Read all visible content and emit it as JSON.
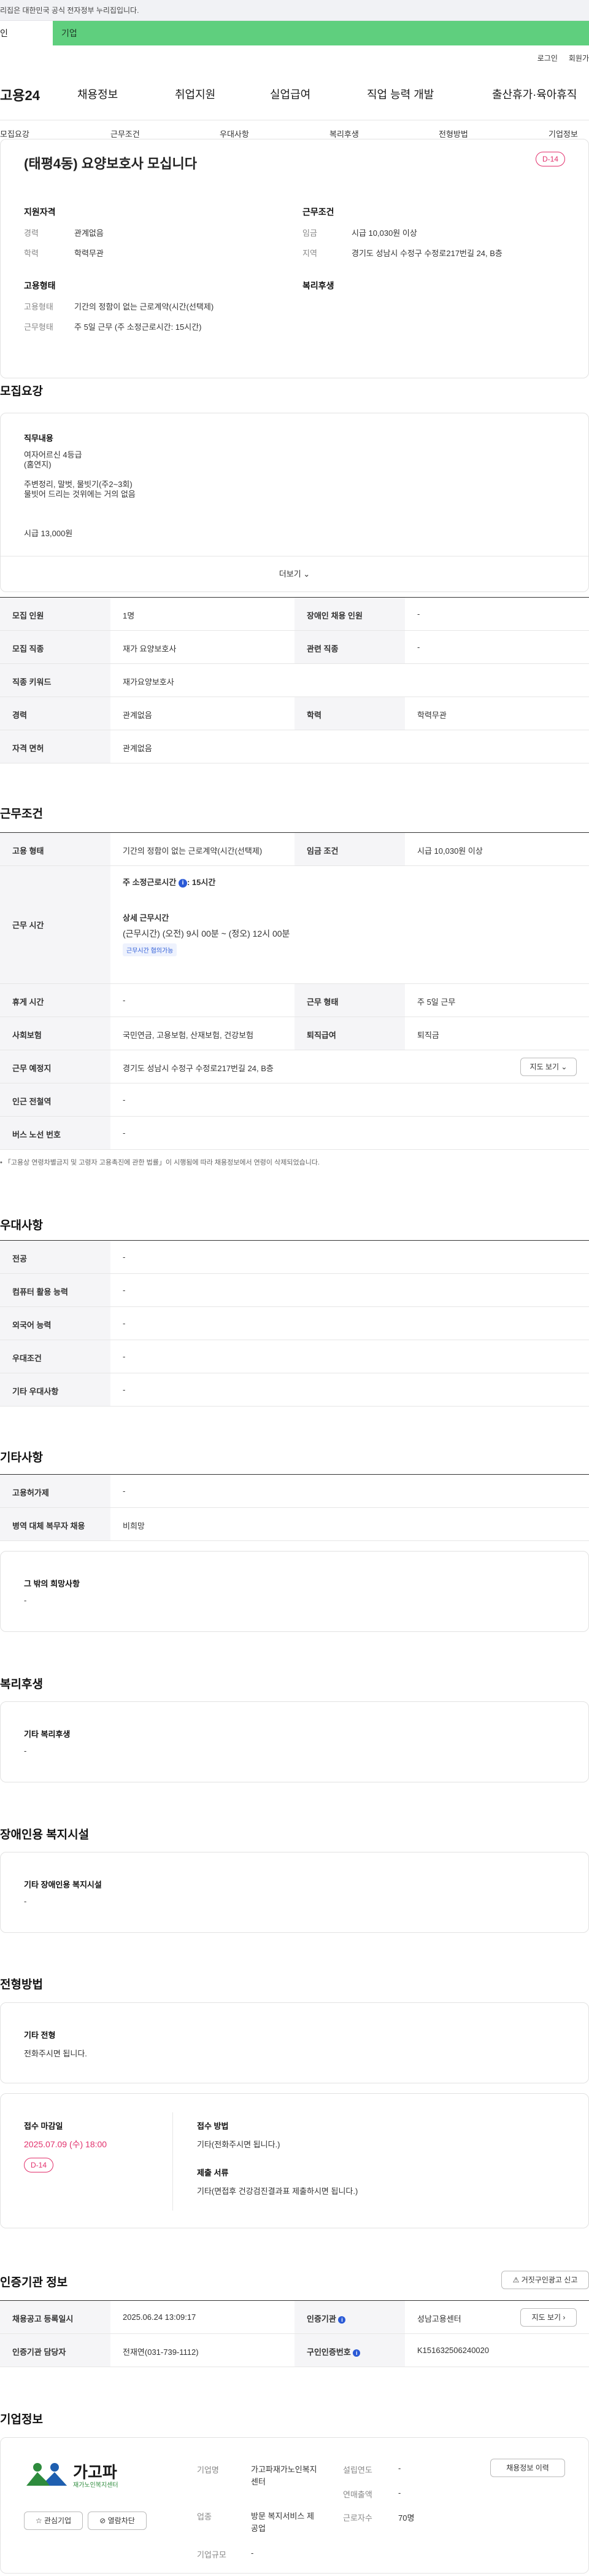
{
  "gov_banner": "이 누리집은 대한민국 공식 전자정부 누리집입니다.",
  "gov_banner_visible": "리집은 대한민국 공식 전자정부 누리집입니다.",
  "top_tabs": {
    "personal": "인",
    "company": "기업"
  },
  "util": {
    "login": "로그인",
    "join": "회원가"
  },
  "gnb": {
    "logo": "고용24",
    "items": [
      "채용정보",
      "취업지원",
      "실업급여",
      "직업 능력 개발",
      "출산휴가·육아휴직"
    ]
  },
  "snb": [
    "모집요강",
    "근무조건",
    "우대사항",
    "복리후생",
    "전형방법",
    "기업정보"
  ],
  "job": {
    "title": "(태평4동) 요양보호사 모십니다",
    "dday": "D-14",
    "qualification_h": "지원자격",
    "career_l": "경력",
    "career": "관계없음",
    "edu_l": "학력",
    "edu": "학력무관",
    "employ_h": "고용형태",
    "emptype_l": "고용형태",
    "emptype": "기간의 정함이 없는 근로계약(시간(선택제)",
    "worktype_l": "근무형태",
    "worktype": "주 5일 근무 (주 소정근로시간: 15시간)",
    "cond_h": "근무조건",
    "wage_l": "임금",
    "wage": "시급 10,030원 이상",
    "region_l": "지역",
    "region": "경기도 성남시 수정구 수정로217번길 24, B층",
    "welfare_h": "복리후생"
  },
  "recruit": {
    "title": "모집요강",
    "duty_h": "직무내용",
    "duty_lines": [
      "여자어르신 4등급",
      "(홈연지)",
      "",
      "주변정리, 말벗, 물빗기(주2~3회)",
      "물빗어 드리는 것위에는 거의 없음",
      "",
      "",
      "시급 13,000원"
    ],
    "more": "더보기",
    "table": [
      {
        "l1": "모집 인원",
        "v1": "1명",
        "l2": "장애인 채용 인원",
        "v2": "-"
      },
      {
        "l1": "모집 직종",
        "v1": "재가 요양보호사",
        "l2": "관련 직종",
        "v2": "-"
      },
      {
        "l1": "직종 키워드",
        "v1": "재가요양보호사"
      },
      {
        "l1": "경력",
        "v1": "관계없음",
        "l2": "학력",
        "v2": "학력무관"
      },
      {
        "l1": "자격 면허",
        "v1": "관계없음"
      }
    ]
  },
  "work": {
    "title": "근무조건",
    "emptype_l": "고용 형태",
    "emptype": "기간의 정함이 없는 근로계약(시간(선택제)",
    "wage_l": "임금 조건",
    "wage": "시급 10,030원 이상",
    "time_l": "근무 시간",
    "weekly": "주 소정근로시간",
    "weekly_hours": ": 15시간",
    "detail_h": "상세 근무시간",
    "detail": "(근무시간) (오전) 9시 00분 ~ (정오) 12시 00분",
    "negotiable": "근무시간 협의가능",
    "break_l": "휴게 시간",
    "break": "-",
    "worktype_l": "근무 형태",
    "worktype": "주 5일 근무",
    "insurance_l": "사회보험",
    "insurance": "국민연금, 고용보험, 산재보험, 건강보험",
    "severance_l": "퇴직급여",
    "severance": "퇴직금",
    "location_l": "근무 예정지",
    "location": "경기도 성남시 수정구 수정로217번길 24, B층",
    "map_btn": "지도 보기",
    "subway_l": "인근 전철역",
    "subway": "-",
    "bus_l": "버스 노선 번호",
    "bus": "-",
    "note": "「고용상 연령차별금지 및 고령자 고용촉진에 관한 법률」이 시행됨에 따라 채용정보에서 연령이 삭제되었습니다."
  },
  "pref": {
    "title": "우대사항",
    "rows": [
      {
        "l": "전공",
        "v": "-"
      },
      {
        "l": "컴퓨터 활용 능력",
        "v": "-"
      },
      {
        "l": "외국어 능력",
        "v": "-"
      },
      {
        "l": "우대조건",
        "v": "-"
      },
      {
        "l": "기타 우대사항",
        "v": "-"
      }
    ]
  },
  "etc": {
    "title": "기타사항",
    "rows": [
      {
        "l": "고용허가제",
        "v": "-"
      },
      {
        "l": "병역 대체 복무자 채용",
        "v": "비희망"
      }
    ],
    "wish_h": "그 밖의 희망사항",
    "wish": "-"
  },
  "welfare": {
    "title": "복리후생",
    "h": "기타 복리후생",
    "v": "-"
  },
  "disabled": {
    "title": "장애인용 복지시설",
    "h": "기타 장애인용 복지시설",
    "v": "-"
  },
  "screening": {
    "title": "전형방법",
    "etc_h": "기타 전형",
    "etc_v": "전화주시면 됩니다.",
    "deadline_h": "접수 마감일",
    "deadline": "2025.07.09 (수) 18:00",
    "dday": "D-14",
    "method_h": "접수 방법",
    "method": "기타(전화주시면 됩니다.)",
    "docs_h": "제출 서류",
    "docs": "기타(면접후 건강검진결과표 제출하시면 됩니다.)"
  },
  "agency": {
    "title": "인증기관 정보",
    "report_btn": "거짓구인광고 신고",
    "reg_l": "채용공고 등록일시",
    "reg": "2025.06.24 13:09:17",
    "org_l": "인증기관",
    "org": "성남고용센터",
    "map_btn": "지도 보기",
    "mgr_l": "인증기관 담당자",
    "mgr": "전재연(031-739-1112)",
    "no_l": "구인인증번호",
    "no": "K151632506240020"
  },
  "company": {
    "title": "기업정보",
    "logo_main": "가고파",
    "logo_sub": "재가노인복지센터",
    "fav_btn": "관심기업",
    "block_btn": "열람차단",
    "name_l": "기업명",
    "name": "가고파재가노인복지센터",
    "founded_l": "설립연도",
    "founded": "-",
    "industry_l": "업종",
    "industry": "방문 복지서비스 제공업",
    "revenue_l": "연매출액",
    "revenue": "-",
    "staff_l": "근로자수",
    "staff": "70명",
    "size_l": "기업규모",
    "size": "-",
    "jobs_btn": "채용정보 이력"
  },
  "colors": {
    "green": "#5fcf7e",
    "dday": "#e2306c",
    "blue": "#2b5ad6"
  }
}
